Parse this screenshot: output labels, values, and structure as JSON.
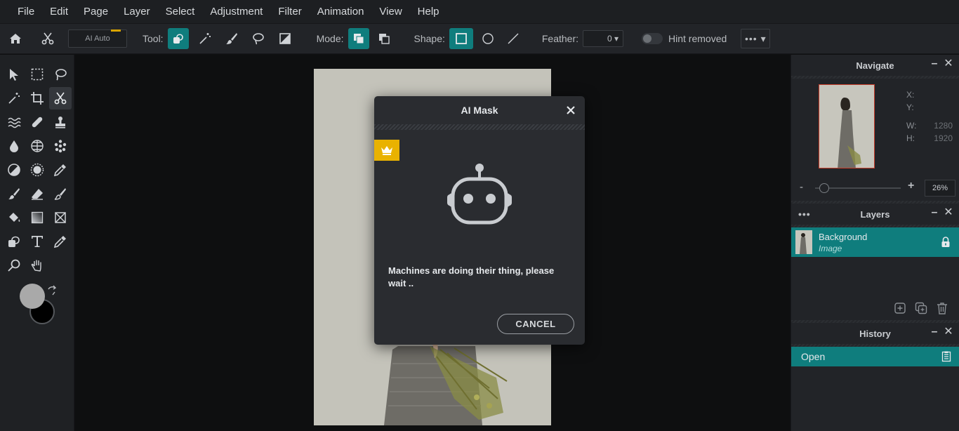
{
  "menu": [
    "File",
    "Edit",
    "Page",
    "Layer",
    "Select",
    "Adjustment",
    "Filter",
    "Animation",
    "View",
    "Help"
  ],
  "options": {
    "ai_auto_label": "AI Auto",
    "tool_label": "Tool:",
    "mode_label": "Mode:",
    "shape_label": "Shape:",
    "feather_label": "Feather:",
    "feather_value": "0 ▾",
    "hint_label": "Hint removed",
    "more_label": "••• ▾"
  },
  "colors": {
    "accent": "#0f7d7d",
    "premium": "#e9b200",
    "foreground_swatch": "#a9a9a9",
    "background_swatch": "#000000"
  },
  "navigate": {
    "title": "Navigate",
    "x_label": "X:",
    "y_label": "Y:",
    "w_label": "W:",
    "w_value": "1280",
    "h_label": "H:",
    "h_value": "1920",
    "zoom_minus": "-",
    "zoom_plus": "+",
    "zoom_value": "26%"
  },
  "layers": {
    "title": "Layers",
    "items": [
      {
        "name": "Background",
        "type": "Image"
      }
    ]
  },
  "history": {
    "title": "History",
    "items": [
      {
        "label": "Open"
      }
    ]
  },
  "panel_controls": {
    "minimize": "–",
    "close": "✕",
    "dots": "•••"
  },
  "modal": {
    "title": "AI Mask",
    "close": "✕",
    "message": "Machines are doing their thing, please wait ..",
    "cancel_label": "CANCEL"
  }
}
